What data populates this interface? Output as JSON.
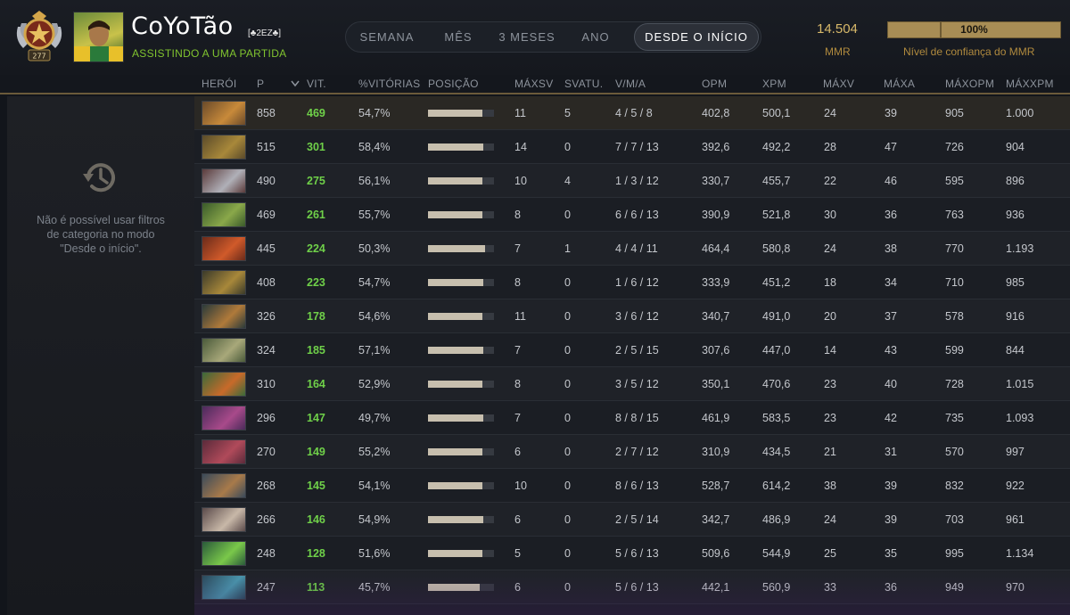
{
  "player": {
    "name": "CoYoTão",
    "tag": "[♣2EZ♣]",
    "status": "ASSISTINDO A UMA PARTIDA",
    "rank_number": "277"
  },
  "tabs": [
    {
      "label": "SEMANA",
      "active": false
    },
    {
      "label": "MÊS",
      "active": false
    },
    {
      "label": "3 MESES",
      "active": false
    },
    {
      "label": "ANO",
      "active": false
    },
    {
      "label": "DESDE O INÍCIO",
      "active": true
    }
  ],
  "mmr": {
    "value": "14.504",
    "label": "MMR"
  },
  "confidence": {
    "value": "100%",
    "level": 1.0,
    "label": "Nível de confiança do MMR"
  },
  "columns": [
    "HERÓI",
    "P",
    "VIT.",
    "%VITÓRIAS",
    "POSIÇÃO",
    "MÁXSV",
    "SVATU.",
    "V/M/A",
    "OPM",
    "XPM",
    "MÁXV",
    "MÁXA",
    "MÁXOPM",
    "MÁXXPM"
  ],
  "sidebar": {
    "message": "Não é possível usar filtros de categoria no modo \"Desde o início\"."
  },
  "colors": {
    "accent_gold": "#d8b96a",
    "wins_green": "#6fd049",
    "status_green": "#80c42f"
  },
  "rows": [
    {
      "hero_colors": [
        "#6a4a2a",
        "#c88a3a"
      ],
      "matches": "858",
      "wins": "469",
      "winrate": "54,7%",
      "position": 0.82,
      "max_streak": "11",
      "cur_streak": "5",
      "kda": "4 / 5 / 8",
      "gpm": "402,8",
      "xpm": "500,1",
      "max_kills": "24",
      "max_assists": "39",
      "max_gpm": "905",
      "max_xpm": "1.000"
    },
    {
      "hero_colors": [
        "#5a4a2a",
        "#a8883a"
      ],
      "matches": "515",
      "wins": "301",
      "winrate": "58,4%",
      "position": 0.84,
      "max_streak": "14",
      "cur_streak": "0",
      "kda": "7 / 7 / 13",
      "gpm": "392,6",
      "xpm": "492,2",
      "max_kills": "28",
      "max_assists": "47",
      "max_gpm": "726",
      "max_xpm": "904"
    },
    {
      "hero_colors": [
        "#5a3a3a",
        "#b0b0b8"
      ],
      "matches": "490",
      "wins": "275",
      "winrate": "56,1%",
      "position": 0.83,
      "max_streak": "10",
      "cur_streak": "4",
      "kda": "1 / 3 / 12",
      "gpm": "330,7",
      "xpm": "455,7",
      "max_kills": "22",
      "max_assists": "46",
      "max_gpm": "595",
      "max_xpm": "896"
    },
    {
      "hero_colors": [
        "#3a5a2a",
        "#8aa84a"
      ],
      "matches": "469",
      "wins": "261",
      "winrate": "55,7%",
      "position": 0.82,
      "max_streak": "8",
      "cur_streak": "0",
      "kda": "6 / 6 / 13",
      "gpm": "390,9",
      "xpm": "521,8",
      "max_kills": "30",
      "max_assists": "36",
      "max_gpm": "763",
      "max_xpm": "936"
    },
    {
      "hero_colors": [
        "#6a2a1a",
        "#d05a2a"
      ],
      "matches": "445",
      "wins": "224",
      "winrate": "50,3%",
      "position": 0.86,
      "max_streak": "7",
      "cur_streak": "1",
      "kda": "4 / 4 / 11",
      "gpm": "464,4",
      "xpm": "580,8",
      "max_kills": "24",
      "max_assists": "38",
      "max_gpm": "770",
      "max_xpm": "1.193"
    },
    {
      "hero_colors": [
        "#3a3a2a",
        "#a8883a"
      ],
      "matches": "408",
      "wins": "223",
      "winrate": "54,7%",
      "position": 0.84,
      "max_streak": "8",
      "cur_streak": "0",
      "kda": "1 / 6 / 12",
      "gpm": "333,9",
      "xpm": "451,2",
      "max_kills": "18",
      "max_assists": "34",
      "max_gpm": "710",
      "max_xpm": "985"
    },
    {
      "hero_colors": [
        "#2a3a3a",
        "#b07a3a"
      ],
      "matches": "326",
      "wins": "178",
      "winrate": "54,6%",
      "position": 0.83,
      "max_streak": "11",
      "cur_streak": "0",
      "kda": "3 / 6 / 12",
      "gpm": "340,7",
      "xpm": "491,0",
      "max_kills": "20",
      "max_assists": "37",
      "max_gpm": "578",
      "max_xpm": "916"
    },
    {
      "hero_colors": [
        "#4a5a3a",
        "#a8a87a"
      ],
      "matches": "324",
      "wins": "185",
      "winrate": "57,1%",
      "position": 0.84,
      "max_streak": "7",
      "cur_streak": "0",
      "kda": "2 / 5 / 15",
      "gpm": "307,6",
      "xpm": "447,0",
      "max_kills": "14",
      "max_assists": "43",
      "max_gpm": "599",
      "max_xpm": "844"
    },
    {
      "hero_colors": [
        "#3a6a3a",
        "#c86a2a"
      ],
      "matches": "310",
      "wins": "164",
      "winrate": "52,9%",
      "position": 0.82,
      "max_streak": "8",
      "cur_streak": "0",
      "kda": "3 / 5 / 12",
      "gpm": "350,1",
      "xpm": "470,6",
      "max_kills": "23",
      "max_assists": "40",
      "max_gpm": "728",
      "max_xpm": "1.015"
    },
    {
      "hero_colors": [
        "#4a2a5a",
        "#a84a8a"
      ],
      "matches": "296",
      "wins": "147",
      "winrate": "49,7%",
      "position": 0.84,
      "max_streak": "7",
      "cur_streak": "0",
      "kda": "8 / 8 / 15",
      "gpm": "461,9",
      "xpm": "583,5",
      "max_kills": "23",
      "max_assists": "42",
      "max_gpm": "735",
      "max_xpm": "1.093"
    },
    {
      "hero_colors": [
        "#5a2a3a",
        "#b04a5a"
      ],
      "matches": "270",
      "wins": "149",
      "winrate": "55,2%",
      "position": 0.83,
      "max_streak": "6",
      "cur_streak": "0",
      "kda": "2 / 7 / 12",
      "gpm": "310,9",
      "xpm": "434,5",
      "max_kills": "21",
      "max_assists": "31",
      "max_gpm": "570",
      "max_xpm": "997"
    },
    {
      "hero_colors": [
        "#3a4a5a",
        "#a87a4a"
      ],
      "matches": "268",
      "wins": "145",
      "winrate": "54,1%",
      "position": 0.82,
      "max_streak": "10",
      "cur_streak": "0",
      "kda": "8 / 6 / 13",
      "gpm": "528,7",
      "xpm": "614,2",
      "max_kills": "38",
      "max_assists": "39",
      "max_gpm": "832",
      "max_xpm": "922"
    },
    {
      "hero_colors": [
        "#5a4a4a",
        "#c8b8a8"
      ],
      "matches": "266",
      "wins": "146",
      "winrate": "54,9%",
      "position": 0.84,
      "max_streak": "6",
      "cur_streak": "0",
      "kda": "2 / 5 / 14",
      "gpm": "342,7",
      "xpm": "486,9",
      "max_kills": "24",
      "max_assists": "39",
      "max_gpm": "703",
      "max_xpm": "961"
    },
    {
      "hero_colors": [
        "#2a5a3a",
        "#7ac84a"
      ],
      "matches": "248",
      "wins": "128",
      "winrate": "51,6%",
      "position": 0.83,
      "max_streak": "5",
      "cur_streak": "0",
      "kda": "5 / 6 / 13",
      "gpm": "509,6",
      "xpm": "544,9",
      "max_kills": "25",
      "max_assists": "35",
      "max_gpm": "995",
      "max_xpm": "1.134"
    },
    {
      "hero_colors": [
        "#2a4a5a",
        "#4a9ab0"
      ],
      "matches": "247",
      "wins": "113",
      "winrate": "45,7%",
      "position": 0.79,
      "max_streak": "6",
      "cur_streak": "0",
      "kda": "5 / 6 / 13",
      "gpm": "442,1",
      "xpm": "560,9",
      "max_kills": "33",
      "max_assists": "36",
      "max_gpm": "949",
      "max_xpm": "970"
    }
  ]
}
